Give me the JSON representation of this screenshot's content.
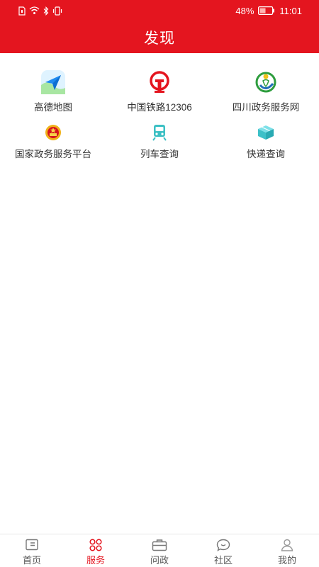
{
  "status_bar": {
    "battery": "48%",
    "time": "11:01"
  },
  "header": {
    "title": "发现"
  },
  "services": [
    {
      "label": "高德地图",
      "icon": "amap-icon"
    },
    {
      "label": "中国铁路12306",
      "icon": "china-railway-icon"
    },
    {
      "label": "四川政务服务网",
      "icon": "sichuan-gov-icon"
    },
    {
      "label": "国家政务服务平台",
      "icon": "national-emblem-icon"
    },
    {
      "label": "列车查询",
      "icon": "train-icon"
    },
    {
      "label": "快递查询",
      "icon": "package-icon"
    }
  ],
  "bottom_nav": [
    {
      "label": "首页",
      "icon": "home-icon",
      "active": false
    },
    {
      "label": "服务",
      "icon": "services-icon",
      "active": true
    },
    {
      "label": "问政",
      "icon": "briefcase-icon",
      "active": false
    },
    {
      "label": "社区",
      "icon": "chat-bubble-icon",
      "active": false
    },
    {
      "label": "我的",
      "icon": "user-icon",
      "active": false
    }
  ],
  "colors": {
    "brand": "#e4151f",
    "tab_active": "#e4151f"
  }
}
